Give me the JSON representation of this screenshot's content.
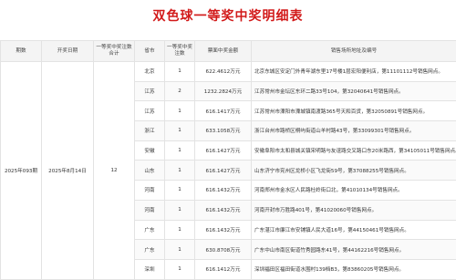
{
  "page_title": "双色球一等奖中奖明细表",
  "headers": [
    "期数",
    "开奖日期",
    "一等奖中奖注数合计",
    "省市",
    "一等奖中奖注数",
    "票面中奖金额",
    "销售场所地址及编号"
  ],
  "summary": {
    "issue": "2025年093期",
    "date": "2025年8月14日",
    "total": "12"
  },
  "rows": [
    {
      "province": "北京",
      "count": "1",
      "amount": "622.4612万元",
      "address": "北京东城区安定门外青年湖东里17号楼1层宏阳便利店，第11101112号销售网点。"
    },
    {
      "province": "江苏",
      "count": "2",
      "amount": "1232.2824万元",
      "address": "江苏常州市金坛区东环二路33号104，第32040641号销售网点。"
    },
    {
      "province": "江苏",
      "count": "1",
      "amount": "616.1417万元",
      "address": "江苏常州市溧阳市溧城镇南渡路365号天和百货，第32050891号销售网点。"
    },
    {
      "province": "浙江",
      "count": "1",
      "amount": "633.1058万元",
      "address": "浙江台州市路桥区桐屿街道山羊村路43号，第33099301号销售网点。"
    },
    {
      "province": "安徽",
      "count": "1",
      "amount": "616.1427万元",
      "address": "安徽阜阳市太和县城关镇宋明路与友谊路交叉路口东20米路西，第34105011号销售网点。"
    },
    {
      "province": "山东",
      "count": "1",
      "amount": "616.1427万元",
      "address": "山东济宁市兖州区龙桥小区飞龙街59号，第37088255号销售网点。"
    },
    {
      "province": "河南",
      "count": "1",
      "amount": "616.1432万元",
      "address": "河南郑州市金水区人民路杜岭街口北，第41010134号销售网点。"
    },
    {
      "province": "河南",
      "count": "1",
      "amount": "616.1432万元",
      "address": "河南开封市万胜路401号，第41020060号销售网点。"
    },
    {
      "province": "广东",
      "count": "1",
      "amount": "616.1432万元",
      "address": "广东湛江市廉江市安铺镇人民大道16号，第44150461号销售网点。"
    },
    {
      "province": "广东",
      "count": "1",
      "amount": "630.8708万元",
      "address": "广东中山市南区街道竹秀园路东41号，第44162216号销售网点。"
    },
    {
      "province": "深圳",
      "count": "1",
      "amount": "616.1412万元",
      "address": "深圳福田区福田街道水围村139档B3，第83860205号销售网点。"
    }
  ]
}
